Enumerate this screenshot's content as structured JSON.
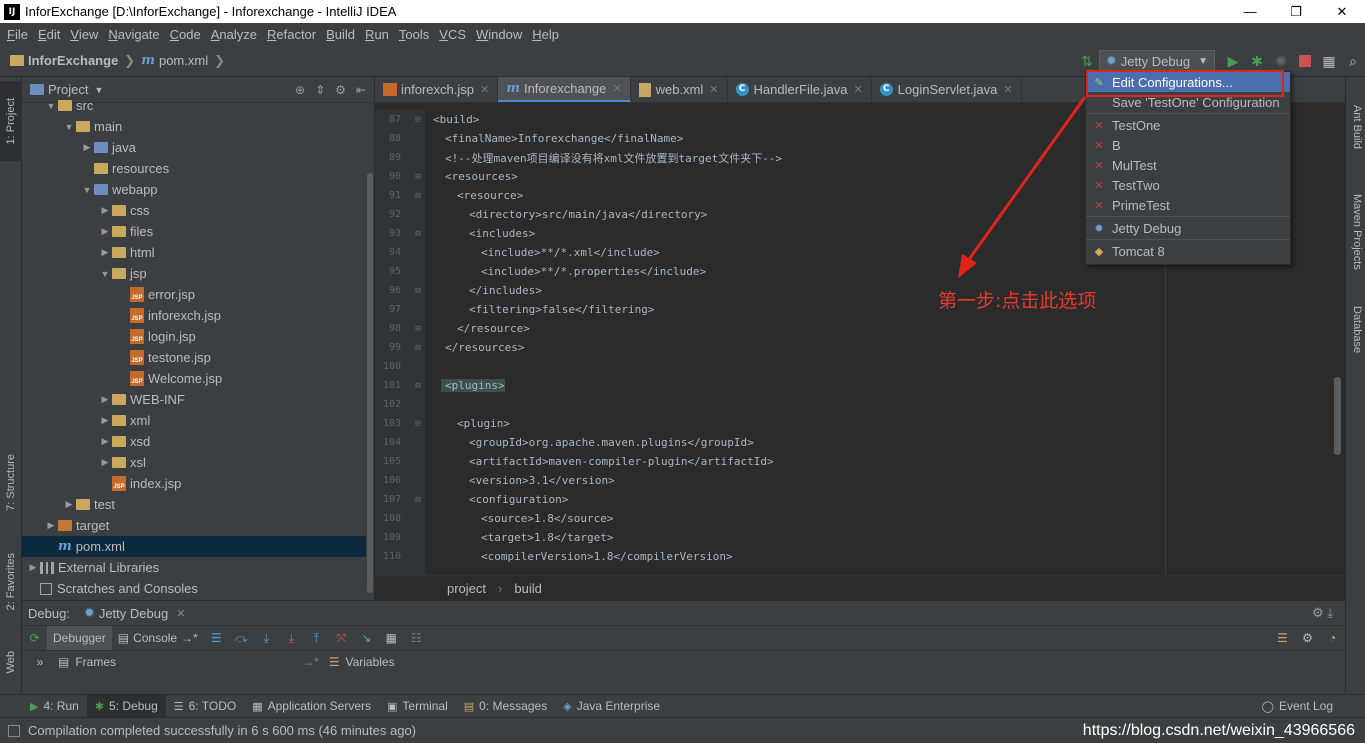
{
  "window": {
    "title": "InforExchange [D:\\InforExchange] - Inforexchange - IntelliJ IDEA",
    "app_badge": "IJ"
  },
  "menu": [
    "File",
    "Edit",
    "View",
    "Navigate",
    "Code",
    "Analyze",
    "Refactor",
    "Build",
    "Run",
    "Tools",
    "VCS",
    "Window",
    "Help"
  ],
  "navbar": {
    "project": "InforExchange",
    "file": "pom.xml",
    "run_config": "Jetty Debug"
  },
  "left_strip": {
    "project_tab": "1: Project",
    "structure_tab": "7: Structure",
    "favorites_tab": "2: Favorites",
    "web_tab": "Web"
  },
  "right_strip": {
    "ant_tab": "Ant Build",
    "maven_tab": "Maven Projects",
    "database_tab": "Database"
  },
  "project_panel": {
    "title": "Project",
    "tree": [
      {
        "label": "src",
        "indent": 1,
        "arrow": "open",
        "icon": "folder"
      },
      {
        "label": "main",
        "indent": 2,
        "arrow": "open",
        "icon": "folder"
      },
      {
        "label": "java",
        "indent": 3,
        "arrow": "closed",
        "icon": "folder-blue"
      },
      {
        "label": "resources",
        "indent": 3,
        "arrow": "none",
        "icon": "folder"
      },
      {
        "label": "webapp",
        "indent": 3,
        "arrow": "open",
        "icon": "folder-blue"
      },
      {
        "label": "css",
        "indent": 4,
        "arrow": "closed",
        "icon": "folder"
      },
      {
        "label": "files",
        "indent": 4,
        "arrow": "closed",
        "icon": "folder"
      },
      {
        "label": "html",
        "indent": 4,
        "arrow": "closed",
        "icon": "folder"
      },
      {
        "label": "jsp",
        "indent": 4,
        "arrow": "open",
        "icon": "folder"
      },
      {
        "label": "error.jsp",
        "indent": 5,
        "arrow": "none",
        "icon": "jsp"
      },
      {
        "label": "inforexch.jsp",
        "indent": 5,
        "arrow": "none",
        "icon": "jsp"
      },
      {
        "label": "login.jsp",
        "indent": 5,
        "arrow": "none",
        "icon": "jsp"
      },
      {
        "label": "testone.jsp",
        "indent": 5,
        "arrow": "none",
        "icon": "jsp"
      },
      {
        "label": "Welcome.jsp",
        "indent": 5,
        "arrow": "none",
        "icon": "jsp"
      },
      {
        "label": "WEB-INF",
        "indent": 4,
        "arrow": "closed",
        "icon": "folder"
      },
      {
        "label": "xml",
        "indent": 4,
        "arrow": "closed",
        "icon": "folder"
      },
      {
        "label": "xsd",
        "indent": 4,
        "arrow": "closed",
        "icon": "folder"
      },
      {
        "label": "xsl",
        "indent": 4,
        "arrow": "closed",
        "icon": "folder"
      },
      {
        "label": "index.jsp",
        "indent": 4,
        "arrow": "none",
        "icon": "jsp"
      },
      {
        "label": "test",
        "indent": 2,
        "arrow": "closed",
        "icon": "folder"
      },
      {
        "label": "target",
        "indent": 1,
        "arrow": "closed",
        "icon": "folder-orange"
      },
      {
        "label": "pom.xml",
        "indent": 1,
        "arrow": "none",
        "icon": "maven",
        "selected": true
      },
      {
        "label": "External Libraries",
        "indent": 0,
        "arrow": "closed",
        "icon": "lib"
      },
      {
        "label": "Scratches and Consoles",
        "indent": 0,
        "arrow": "none",
        "icon": "scratch"
      }
    ]
  },
  "editor": {
    "tabs": [
      {
        "label": "inforexch.jsp",
        "icon": "jsp",
        "active": false
      },
      {
        "label": "Inforexchange",
        "icon": "maven",
        "active": true
      },
      {
        "label": "web.xml",
        "icon": "xml",
        "active": false
      },
      {
        "label": "HandlerFile.java",
        "icon": "class",
        "active": false
      },
      {
        "label": "LoginServlet.java",
        "icon": "class",
        "active": false
      }
    ],
    "lines": [
      {
        "n": "87",
        "indent": 0,
        "text": "<build>",
        "kind": "tag",
        "fold": true
      },
      {
        "n": "88",
        "indent": 1,
        "text": "<finalName>Inforexchange</finalName>",
        "kind": "tag"
      },
      {
        "n": "89",
        "indent": 1,
        "text": "<!--处理maven项目编译没有将xml文件放置到target文件夹下-->",
        "kind": "comment"
      },
      {
        "n": "90",
        "indent": 1,
        "text": "<resources>",
        "kind": "tag",
        "fold": true
      },
      {
        "n": "91",
        "indent": 2,
        "text": "<resource>",
        "kind": "tag",
        "fold": true
      },
      {
        "n": "92",
        "indent": 3,
        "text": "<directory>src/main/java</directory>",
        "kind": "tag"
      },
      {
        "n": "93",
        "indent": 3,
        "text": "<includes>",
        "kind": "tag",
        "fold": true
      },
      {
        "n": "94",
        "indent": 4,
        "text": "<include>**/*.xml</include>",
        "kind": "tag"
      },
      {
        "n": "95",
        "indent": 4,
        "text": "<include>**/*.properties</include>",
        "kind": "tag"
      },
      {
        "n": "96",
        "indent": 3,
        "text": "</includes>",
        "kind": "tag",
        "fold": true
      },
      {
        "n": "97",
        "indent": 3,
        "text": "<filtering>false</filtering>",
        "kind": "tag"
      },
      {
        "n": "98",
        "indent": 2,
        "text": "</resource>",
        "kind": "tag",
        "fold": true
      },
      {
        "n": "99",
        "indent": 1,
        "text": "</resources>",
        "kind": "tag",
        "fold": true
      },
      {
        "n": "100",
        "indent": 0,
        "text": "",
        "kind": "tag"
      },
      {
        "n": "101",
        "indent": 1,
        "text": "<plugins>",
        "kind": "tag",
        "fold": true,
        "highlight": true
      },
      {
        "n": "102",
        "indent": 0,
        "text": "",
        "kind": "tag"
      },
      {
        "n": "103",
        "indent": 2,
        "text": "<plugin>",
        "kind": "tag",
        "fold": true
      },
      {
        "n": "104",
        "indent": 3,
        "text": "<groupId>org.apache.maven.plugins</groupId>",
        "kind": "tag"
      },
      {
        "n": "105",
        "indent": 3,
        "text": "<artifactId>maven-compiler-plugin</artifactId>",
        "kind": "tag"
      },
      {
        "n": "106",
        "indent": 3,
        "text": "<version>3.1</version>",
        "kind": "tag"
      },
      {
        "n": "107",
        "indent": 3,
        "text": "<configuration>",
        "kind": "tag",
        "fold": true
      },
      {
        "n": "108",
        "indent": 4,
        "text": "<source>1.8</source>",
        "kind": "tag"
      },
      {
        "n": "109",
        "indent": 4,
        "text": "<target>1.8</target>",
        "kind": "tag"
      },
      {
        "n": "110",
        "indent": 4,
        "text": "<compilerVersion>1.8</compilerVersion>",
        "kind": "tag"
      }
    ],
    "breadcrumb": [
      "project",
      "build"
    ]
  },
  "dropdown": {
    "items": [
      {
        "label": "Edit Configurations...",
        "icon": "edit",
        "highlight": true
      },
      {
        "label": "Save 'TestOne' Configuration",
        "icon": "none"
      },
      {
        "sep": true
      },
      {
        "label": "TestOne",
        "icon": "x"
      },
      {
        "label": "B",
        "icon": "x"
      },
      {
        "label": "MulTest",
        "icon": "x"
      },
      {
        "label": "TestTwo",
        "icon": "x"
      },
      {
        "label": "PrimeTest",
        "icon": "x"
      },
      {
        "sep": true
      },
      {
        "label": "Jetty Debug",
        "icon": "gear"
      },
      {
        "sep": true
      },
      {
        "label": "Tomcat 8",
        "icon": "tomcat"
      }
    ]
  },
  "annotation": {
    "text": "第一步:点击此选项",
    "color": "#e83a2b"
  },
  "debug": {
    "label": "Debug:",
    "config": "Jetty Debug",
    "debugger_tab": "Debugger",
    "console_tab": "Console",
    "frames_label": "Frames",
    "variables_label": "Variables"
  },
  "bottom_tabs": [
    {
      "label": "4: Run",
      "glyph": "▶",
      "color": "#499c54"
    },
    {
      "label": "5: Debug",
      "glyph": "✱",
      "color": "#499c54",
      "active": true
    },
    {
      "label": "6: TODO",
      "glyph": "☰",
      "color": "#bbbbbb"
    },
    {
      "label": "Application Servers",
      "glyph": "▦",
      "color": "#bbbbbb"
    },
    {
      "label": "Terminal",
      "glyph": "▣",
      "color": "#bbbbbb"
    },
    {
      "label": "0: Messages",
      "glyph": "▤",
      "color": "#c7a66a"
    },
    {
      "label": "Java Enterprise",
      "glyph": "◈",
      "color": "#6ca2d6"
    }
  ],
  "event_log": "Event Log",
  "status": {
    "message": "Compilation completed successfully in 6 s 600 ms (46 minutes ago)",
    "watermark": "https://blog.csdn.net/weixin_43966566"
  }
}
